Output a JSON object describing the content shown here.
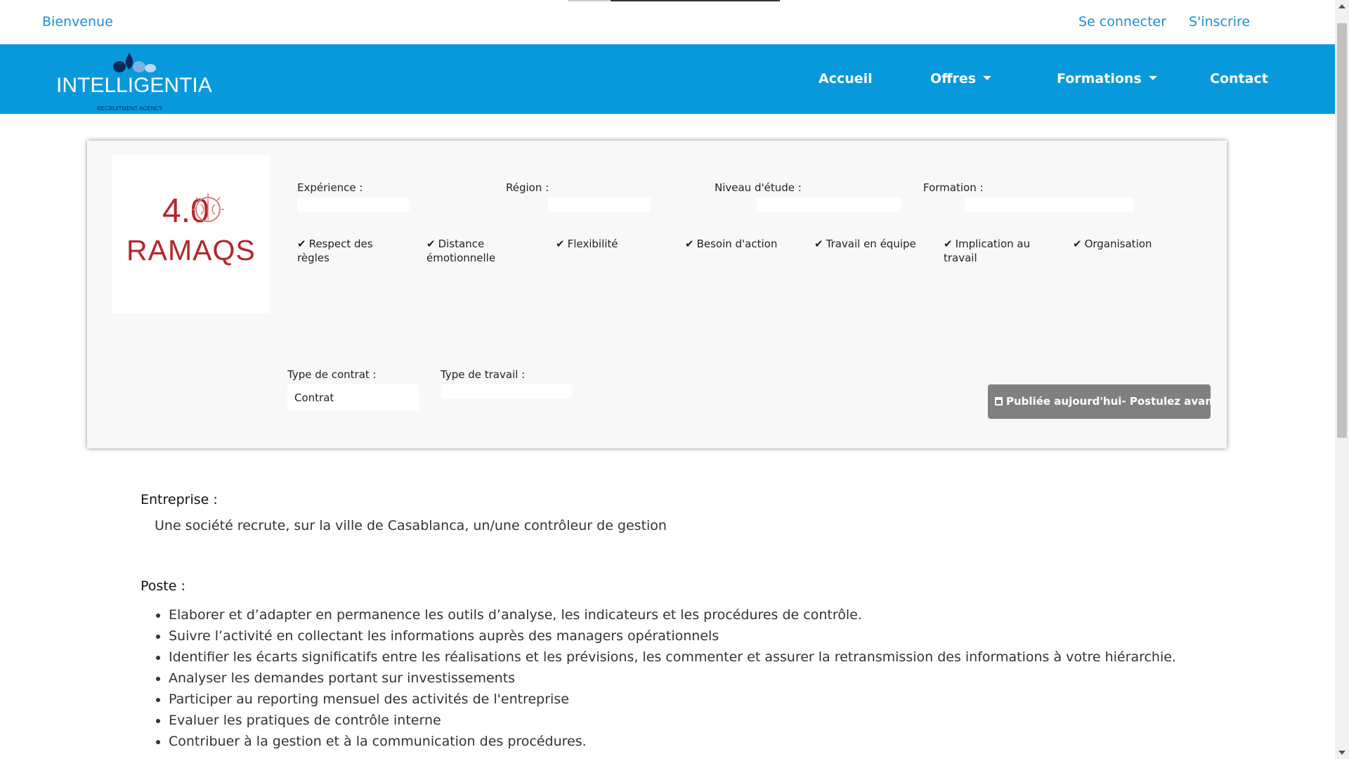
{
  "topbar": {
    "welcome": "Bienvenue",
    "login": "Se connecter",
    "register": "S'inscrire"
  },
  "navbar": {
    "brand": "INTELLIGENTIA",
    "tagline": "RECRUITMENT AGENCY",
    "items": [
      {
        "label": "Accueil",
        "dropdown": false
      },
      {
        "label": "Offres",
        "dropdown": true
      },
      {
        "label": "Formations",
        "dropdown": true
      },
      {
        "label": "Contact",
        "dropdown": false
      }
    ],
    "color": "#0899dc"
  },
  "job": {
    "company_logo": {
      "num": "4.0",
      "name": "RAMAQS",
      "color": "#b3262a"
    },
    "fields": {
      "experience": "Expérience :",
      "region": "Région :",
      "niveau": "Niveau d'étude :",
      "formation": "Formation :"
    },
    "traits": [
      "Respect des règles",
      "Distance émotionnelle",
      "Flexibilité",
      "Besoin d'action",
      "Travail en équipe",
      "Implication au travail",
      "Organisation"
    ],
    "contract_label": "Type de contrat :",
    "contract_value": "Contrat",
    "work_label": "Type de travail :",
    "publish": "Publiée aujourd'hui- Postulez avant le"
  },
  "description": {
    "company_title": "Entreprise :",
    "company_text": "Une société recrute, sur la ville de Casablanca, un/une contrôleur de gestion",
    "poste_title": "Poste :",
    "duties": [
      "Elaborer et d’adapter en permanence les outils d’analyse, les indicateurs et les procédures de contrôle.",
      "Suivre l’activité en collectant les informations auprès des managers opérationnels",
      "Identifier les écarts significatifs entre les réalisations et les prévisions, les commenter et assurer la retransmission des informations à votre hiérarchie.",
      "Analyser les demandes portant sur investissements",
      "Participer au reporting mensuel des activités de l'entreprise",
      "Evaluer les pratiques de contrôle interne",
      "Contribuer à la gestion et à la communication des procédures."
    ]
  }
}
